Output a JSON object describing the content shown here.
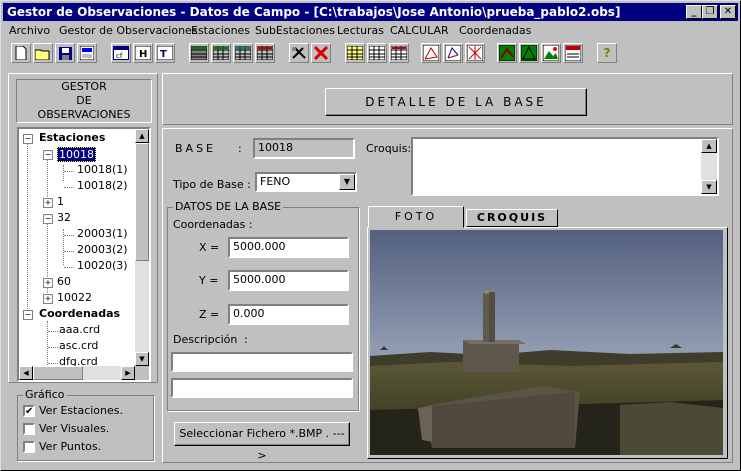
{
  "window": {
    "title": "Gestor de Observaciones - Datos de Campo - [C:\\trabajos\\Jose Antonio\\prueba_pablo2.obs]",
    "minimize": "_",
    "restore": "❐",
    "close": "✕"
  },
  "menu": [
    "Archivo",
    "Gestor de Observaciones",
    "Estaciones",
    "SubEstaciones",
    "Lecturas",
    "CALCULAR",
    "Coordenadas"
  ],
  "toolbar": {
    "help_label": "?"
  },
  "sidebar": {
    "header_line1": "GESTOR",
    "header_line2": "DE",
    "header_line3": "OBSERVACIONES",
    "tree": {
      "estaciones_label": "Estaciones",
      "node_10018": "10018",
      "node_10018_1": "10018(1)",
      "node_10018_2": "10018(2)",
      "node_1": "1",
      "node_32": "32",
      "node_20003_1": "20003(1)",
      "node_20003_2": "20003(2)",
      "node_10020_3": "10020(3)",
      "node_60": "60",
      "node_10022": "10022",
      "coordenadas_label": "Coordenadas",
      "file_1": "aaa.crd",
      "file_2": "asc.crd",
      "file_3": "dfg.crd"
    },
    "grafico": {
      "title": "Gráfico",
      "ver_estaciones": "Ver Estaciones.",
      "ver_visuales": "Ver Visuales.",
      "ver_puntos": "Ver Puntos.",
      "check_mark": "✔"
    }
  },
  "main": {
    "title": "DETALLE DE LA BASE",
    "base_label": "BASE",
    "base_colon": ":",
    "base_value": "10018",
    "tipo_label": "Tipo de Base :",
    "tipo_value": "FENO",
    "croquis_label": "Croquis:",
    "datos_title": "DATOS DE LA BASE",
    "coordenadas_label": "Coordenadas  :",
    "x_label": "X =",
    "x_value": "5000.000",
    "y_label": "Y =",
    "y_value": "5000.000",
    "z_label": "Z =",
    "z_value": "0.000",
    "descripcion_label": "Descripción",
    "descripcion_colon": ":",
    "desc_line1": "",
    "desc_line2": "",
    "select_button": "Seleccionar Fichero  *.BMP . --->",
    "tab_foto": "FOTO",
    "tab_croquis": "CROQUIS"
  }
}
